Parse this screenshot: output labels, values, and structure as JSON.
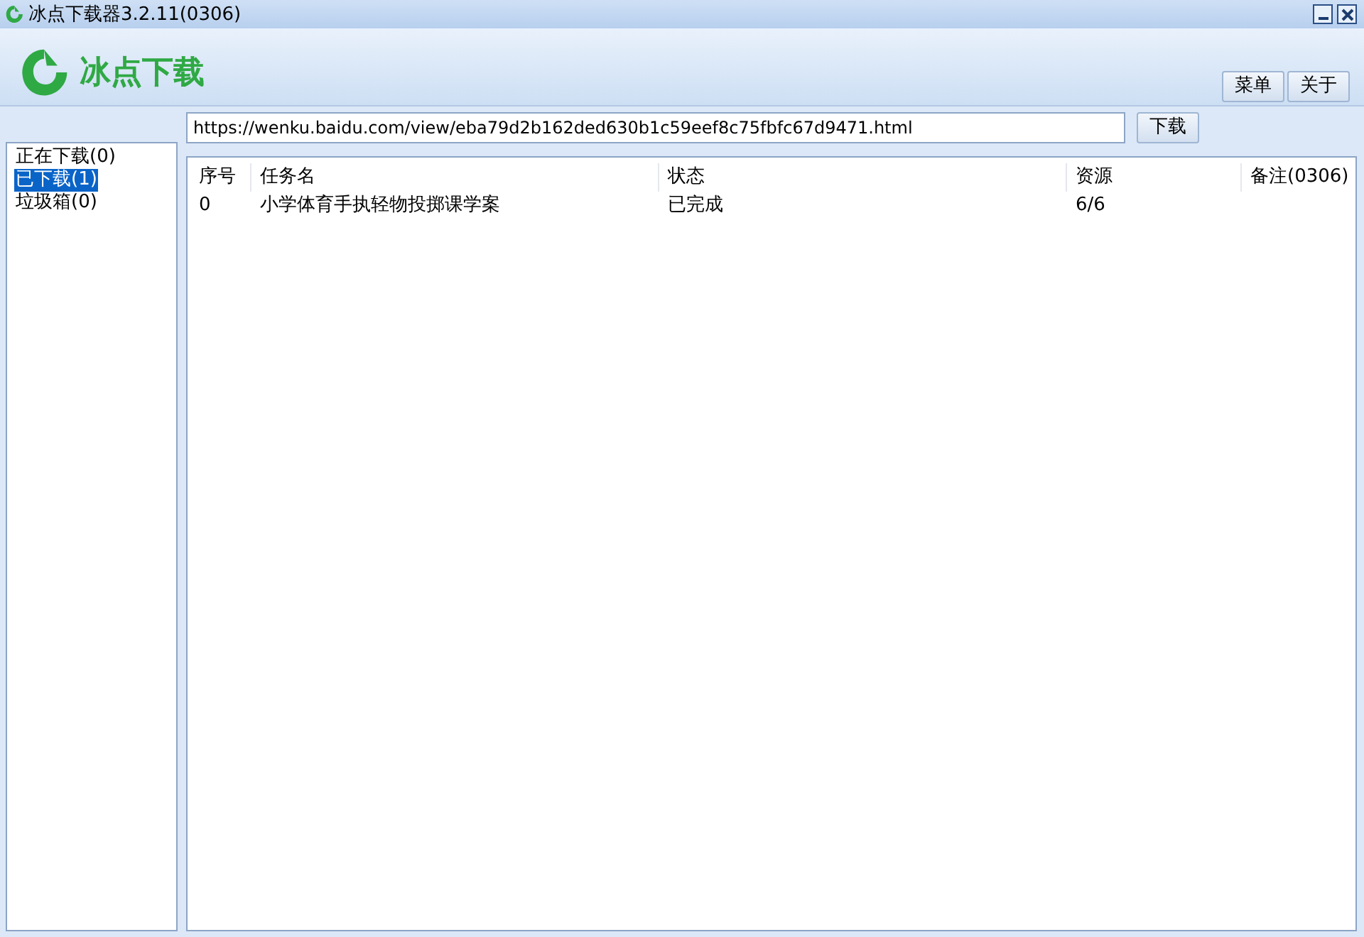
{
  "window": {
    "title": "冰点下载器3.2.11(0306)"
  },
  "logo": {
    "text": "冰点下载"
  },
  "header_buttons": [
    "菜单",
    "关于"
  ],
  "url_field": {
    "value": "https://wenku.baidu.com/view/eba79d2b162ded630b1c59eef8c75fbfc67d9471.html"
  },
  "download_button": "下载",
  "sidebar": {
    "items": [
      {
        "label": "正在下载(0)",
        "selected": false
      },
      {
        "label": "已下载(1)",
        "selected": true
      },
      {
        "label": "垃圾箱(0)",
        "selected": false
      }
    ]
  },
  "table": {
    "columns": [
      "序号",
      "任务名",
      "状态",
      "资源",
      "备注(0306)"
    ],
    "rows": [
      [
        "0",
        "小学体育手执轻物投掷课学案",
        "已完成",
        "6/6",
        ""
      ]
    ]
  }
}
